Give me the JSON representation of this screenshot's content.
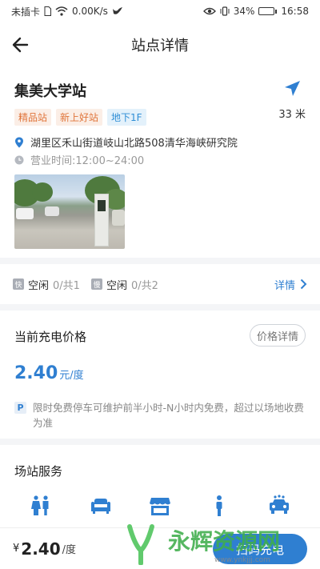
{
  "status_bar": {
    "carrier": "未插卡",
    "speed": "0.00K/s",
    "battery": "34%",
    "battery_level": 0.34,
    "time": "16:58"
  },
  "header": {
    "title": "站点详情"
  },
  "station": {
    "name": "集美大学站",
    "distance": "33 米",
    "tags": [
      {
        "label": "精品站",
        "color": "#e0753b"
      },
      {
        "label": "新上好站",
        "color": "#e0753b"
      },
      {
        "label": "地下1F",
        "color": "#2f8ed6"
      }
    ],
    "address": "湖里区禾山街道岐山北路508清华海峡研究院",
    "hours": "营业时间:12:00~24:00"
  },
  "chargers": {
    "fast": {
      "badge": "快",
      "status": "空闲",
      "count": "0/共1"
    },
    "slow": {
      "badge": "慢",
      "status": "空闲",
      "count": "0/共2"
    },
    "detail_label": "详情"
  },
  "price": {
    "title": "当前充电价格",
    "detail_button": "价格详情",
    "value": "2.40",
    "unit": "元/度",
    "parking_icon": "P",
    "parking_note": "限时免费停车可维护前半小时-N小时内免费，超过以场地收费为准"
  },
  "services": {
    "title": "场站服务",
    "icons": [
      "restroom-icon",
      "lounge-sofa-icon",
      "shop-icon",
      "person-icon",
      "car-wash-icon"
    ]
  },
  "bottom_bar": {
    "currency": "¥",
    "price": "2.40",
    "unit": "/度",
    "button_label": "扫码充电"
  },
  "watermark": {
    "text": "永辉资源网",
    "url": "www.ynkjjj.com"
  },
  "colors": {
    "accent": "#2f7fd1",
    "tag_orange": "#e0753b",
    "tag_blue": "#2f8ed6",
    "background": "#f4f5f7"
  }
}
